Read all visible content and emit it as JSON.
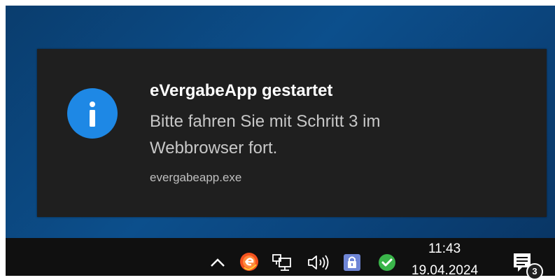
{
  "toast": {
    "title": "eVergabeApp gestartet",
    "body": "Bitte fahren Sie mit Schritt 3 im Webbrowser fort.",
    "source": "evergabeapp.exe",
    "icon": "info-icon",
    "accent_color": "#1e88e5"
  },
  "taskbar": {
    "tray_icons": [
      "chevron-up-icon",
      "evergabe-app-icon",
      "network-icon",
      "volume-icon",
      "lock-icon",
      "check-icon"
    ],
    "clock": {
      "time": "11:43",
      "date": "19.04.2024"
    },
    "notifications": {
      "icon": "action-center-icon",
      "count": "3"
    }
  }
}
